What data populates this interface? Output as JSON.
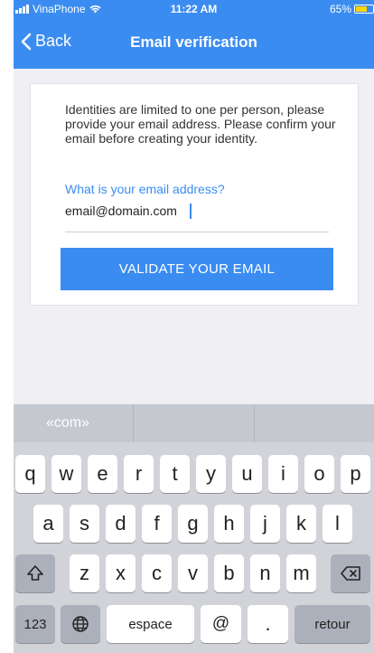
{
  "status_bar": {
    "carrier": "VinaPhone",
    "time": "11:22 AM",
    "battery": "65%"
  },
  "nav": {
    "back_label": "Back",
    "title": "Email verification"
  },
  "card": {
    "intro_text": "Identities are limited to one per person, please provide your email address. Please confirm your email before creating your identity.",
    "question_label": "What is your email address?",
    "email_value": "email@domain.com",
    "validate_label": "VALIDATE YOUR EMAIL"
  },
  "keyboard": {
    "suggestions": [
      "«com»",
      "",
      ""
    ],
    "row1": [
      "q",
      "w",
      "e",
      "r",
      "t",
      "y",
      "u",
      "i",
      "o",
      "p"
    ],
    "row2": [
      "a",
      "s",
      "d",
      "f",
      "g",
      "h",
      "j",
      "k",
      "l"
    ],
    "row3": [
      "z",
      "x",
      "c",
      "v",
      "b",
      "n",
      "m"
    ],
    "numbers_label": "123",
    "space_label": "espace",
    "at_label": "@",
    "dot_label": ".",
    "return_label": "retour"
  },
  "colors": {
    "accent": "#3b8cf0",
    "keyboard_bg": "#d1d3d9",
    "screen_bg": "#efeff4"
  },
  "icons": {
    "back": "chevron-left-icon",
    "wifi": "wifi-icon",
    "globe": "globe-icon",
    "shift": "shift-icon",
    "delete": "delete-icon"
  }
}
